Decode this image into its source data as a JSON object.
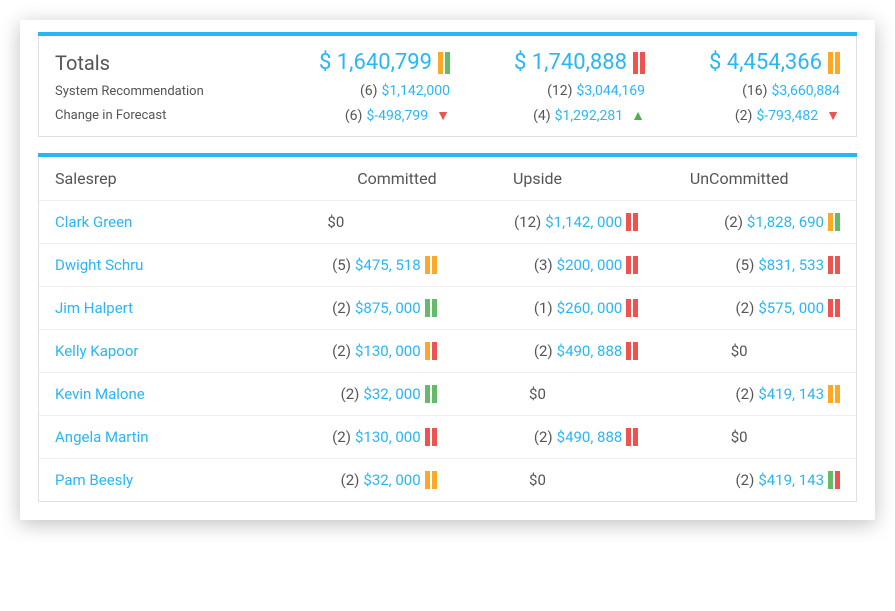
{
  "totals": {
    "title": "Totals",
    "columns": [
      {
        "amount": "$ 1,640,799",
        "bar1": "orange",
        "bar2": "green"
      },
      {
        "amount": "$ 1,740,888",
        "bar1": "red",
        "bar2": "red"
      },
      {
        "amount": "$ 4,454,366",
        "bar1": "orange",
        "bar2": "orange"
      }
    ],
    "sys_rec_label": "System Recommendation",
    "sys_rec": [
      {
        "count": "(6)",
        "value": "$1,142,000"
      },
      {
        "count": "(12)",
        "value": "$3,044,169"
      },
      {
        "count": "(16)",
        "value": "$3,660,884"
      }
    ],
    "change_label": "Change in Forecast",
    "change": [
      {
        "count": "(6)",
        "value": "$-498,799",
        "dir": "down"
      },
      {
        "count": "(4)",
        "value": "$1,292,281",
        "dir": "up"
      },
      {
        "count": "(2)",
        "value": "$-793,482",
        "dir": "down"
      }
    ]
  },
  "table": {
    "headers": [
      "Salesrep",
      "Committed",
      "Upside",
      "UnCommitted"
    ],
    "rows": [
      {
        "name": "Clark Green",
        "cells": [
          {
            "plain": "$0"
          },
          {
            "count": "(12)",
            "value": "$1,142, 000",
            "bar1": "red",
            "bar2": "red"
          },
          {
            "count": "(2)",
            "value": "$1,828, 690",
            "bar1": "orange",
            "bar2": "green"
          }
        ]
      },
      {
        "name": "Dwight Schru",
        "cells": [
          {
            "count": "(5)",
            "value": "$475, 518",
            "bar1": "orange",
            "bar2": "orange"
          },
          {
            "count": "(3)",
            "value": "$200, 000",
            "bar1": "red",
            "bar2": "red"
          },
          {
            "count": "(5)",
            "value": "$831, 533",
            "bar1": "red",
            "bar2": "red"
          }
        ]
      },
      {
        "name": "Jim Halpert",
        "cells": [
          {
            "count": "(2)",
            "value": "$875, 000",
            "bar1": "green",
            "bar2": "green"
          },
          {
            "count": "(1)",
            "value": "$260, 000",
            "bar1": "red",
            "bar2": "red"
          },
          {
            "count": "(2)",
            "value": "$575, 000",
            "bar1": "red",
            "bar2": "red"
          }
        ]
      },
      {
        "name": "Kelly Kapoor",
        "cells": [
          {
            "count": "(2)",
            "value": "$130, 000",
            "bar1": "orange",
            "bar2": "red"
          },
          {
            "count": "(2)",
            "value": "$490, 888",
            "bar1": "red",
            "bar2": "red"
          },
          {
            "plain": "$0"
          }
        ]
      },
      {
        "name": "Kevin Malone",
        "cells": [
          {
            "count": "(2)",
            "value": "$32, 000",
            "bar1": "green",
            "bar2": "green"
          },
          {
            "plain": "$0"
          },
          {
            "count": "(2)",
            "value": "$419, 143",
            "bar1": "orange",
            "bar2": "orange"
          }
        ]
      },
      {
        "name": "Angela Martin",
        "cells": [
          {
            "count": "(2)",
            "value": "$130, 000",
            "bar1": "red",
            "bar2": "red"
          },
          {
            "count": "(2)",
            "value": "$490, 888",
            "bar1": "red",
            "bar2": "red"
          },
          {
            "plain": "$0"
          }
        ]
      },
      {
        "name": "Pam Beesly",
        "cells": [
          {
            "count": "(2)",
            "value": "$32, 000",
            "bar1": "orange",
            "bar2": "orange"
          },
          {
            "plain": "$0"
          },
          {
            "count": "(2)",
            "value": "$419, 143",
            "bar1": "green",
            "bar2": "red"
          }
        ]
      }
    ]
  }
}
